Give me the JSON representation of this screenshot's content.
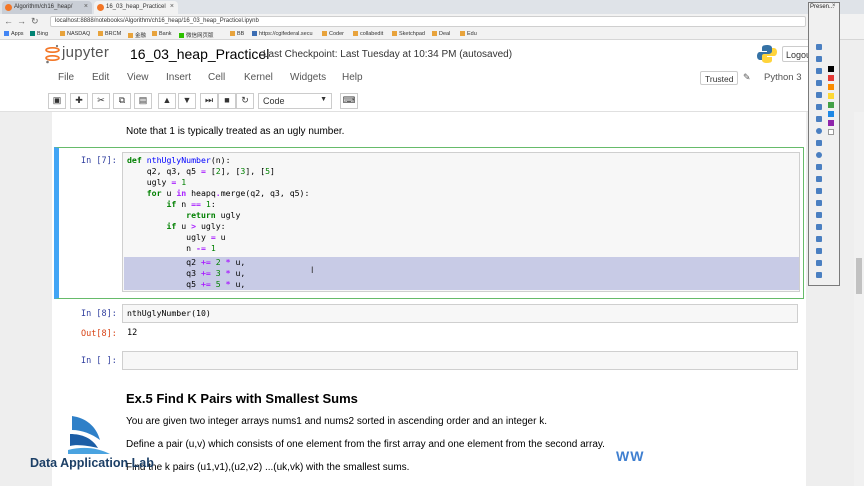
{
  "browser": {
    "tabs": [
      {
        "label": "Algorithm/ch16_heap/",
        "active": false
      },
      {
        "label": "16_03_heap_Practicel",
        "active": true
      }
    ],
    "url": "localhost:8888/notebooks/Algorithm/ch16_heap/16_03_heap_Practicel.ipynb",
    "bookmarks": [
      "Apps",
      "Bing",
      "NASDAQ",
      "BRCM",
      "金融",
      "Bank",
      "微信网页版",
      "BB",
      "https://cgifederal.secu",
      "Coder",
      "collabedit",
      "Sketchpad",
      "Deal",
      "Edu"
    ]
  },
  "jupyter": {
    "logo_text": "jupyter",
    "notebook_title": "16_03_heap_Practicel",
    "checkpoint": "Last Checkpoint: Last Tuesday at 10:34 PM (autosaved)",
    "logout_label": "Logou",
    "menus": [
      "File",
      "Edit",
      "View",
      "Insert",
      "Cell",
      "Kernel",
      "Widgets",
      "Help"
    ],
    "trusted_label": "Trusted",
    "kernel_name": "Python 3",
    "cell_type": "Code"
  },
  "notebook": {
    "note_text": "Note that 1 is typically treated as an ugly number.",
    "cell7": {
      "prompt": "In [7]:",
      "lines": [
        "def nthUglyNumber(n):",
        "    q2, q3, q5 = [2], [3], [5]",
        "    ugly = 1",
        "    for u in heapq.merge(q2, q3, q5):",
        "        if n == 1:",
        "            return ugly",
        "        if u > ugly:",
        "            ugly = u",
        "            n -= 1",
        "            q2 += 2 * u,",
        "            q3 += 3 * u,",
        "            q5 += 5 * u,"
      ]
    },
    "cell8": {
      "prompt": "In [8]:",
      "code": "nthUglyNumber(10)",
      "out_prompt": "Out[8]:",
      "output": "12"
    },
    "cell_empty": {
      "prompt": "In [ ]:"
    },
    "section_heading": "Ex.5 Find K Pairs with Smallest Sums",
    "para1": "You are given two integer arrays nums1 and nums2 sorted in ascending order and an integer k.",
    "para2": "Define a pair (u,v) which consists of one element from the first array and one element from the second array.",
    "para3": "Find the k pairs (u1,v1),(u2,v2) ...(uk,vk) with the smallest sums."
  },
  "palette": {
    "title": "Presen..."
  },
  "watermark": {
    "org_text": "Data Application Lab",
    "corner_text": "WW"
  },
  "colors": {
    "selected_cell_border": "#66bb6a",
    "selected_cell_bar": "#42a5f5",
    "highlight": "#c8cbe6",
    "jupyter_orange": "#f37626"
  }
}
